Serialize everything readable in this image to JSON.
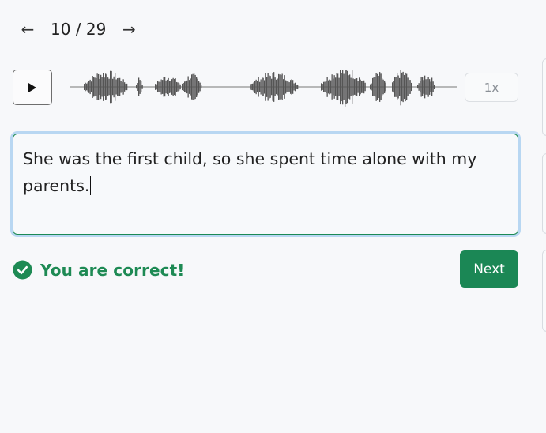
{
  "nav": {
    "prev_icon": "arrow-left-icon",
    "next_icon": "arrow-right-icon",
    "counter": "10 / 29",
    "prev_glyph": "←",
    "next_glyph": "→"
  },
  "player": {
    "play_icon": "play-icon",
    "speed_label": "1x"
  },
  "answer": {
    "text": "She was the first child, so she spent time alone with my parents."
  },
  "feedback": {
    "icon": "check-circle-icon",
    "message": "You are correct!",
    "color": "#1e8a54"
  },
  "actions": {
    "next_label": "Next",
    "next_color": "#1b8755"
  },
  "colors": {
    "background": "#f7f8fa",
    "focus_ring": "#b8d7f2",
    "input_border": "#1c8a55",
    "waveform": "#555555"
  }
}
